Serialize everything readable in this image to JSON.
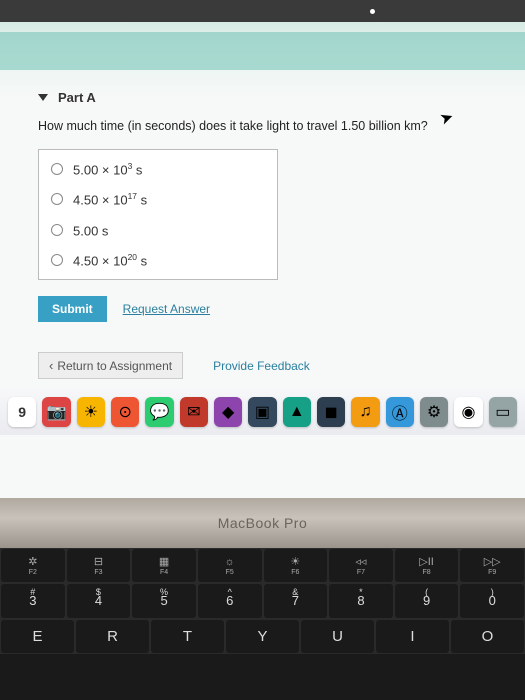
{
  "browser": {
    "title": ""
  },
  "part": {
    "label": "Part A"
  },
  "question": "How much time (in seconds) does it take light to travel 1.50 billion km?",
  "options": [
    {
      "base": "5.00 × 10",
      "exp": "3",
      "unit": " s"
    },
    {
      "base": "4.50 × 10",
      "exp": "17",
      "unit": " s"
    },
    {
      "base": "5.00 s",
      "exp": "",
      "unit": ""
    },
    {
      "base": "4.50 × 10",
      "exp": "20",
      "unit": " s"
    }
  ],
  "buttons": {
    "submit": "Submit",
    "request_answer": "Request Answer",
    "return": "Return to Assignment",
    "feedback": "Provide Feedback"
  },
  "dock": {
    "calendar_day": "9"
  },
  "laptop_label": "MacBook Pro",
  "fn_row": [
    {
      "sym": "✲",
      "label": "F2"
    },
    {
      "sym": "⊟",
      "label": "F3"
    },
    {
      "sym": "▦",
      "label": "F4"
    },
    {
      "sym": "☼",
      "label": "F5"
    },
    {
      "sym": "☀",
      "label": "F6"
    },
    {
      "sym": "◃◃",
      "label": "F7"
    },
    {
      "sym": "▷II",
      "label": "F8"
    },
    {
      "sym": "▷▷",
      "label": "F9"
    }
  ],
  "num_row": [
    {
      "top": "#",
      "mid": "3"
    },
    {
      "top": "$",
      "mid": "4"
    },
    {
      "top": "%",
      "mid": "5"
    },
    {
      "top": "^",
      "mid": "6"
    },
    {
      "top": "&",
      "mid": "7"
    },
    {
      "top": "*",
      "mid": "8"
    },
    {
      "top": "(",
      "mid": "9"
    },
    {
      "top": ")",
      "mid": "0"
    }
  ],
  "letter_row": [
    "E",
    "R",
    "T",
    "Y",
    "U",
    "I",
    "O"
  ]
}
